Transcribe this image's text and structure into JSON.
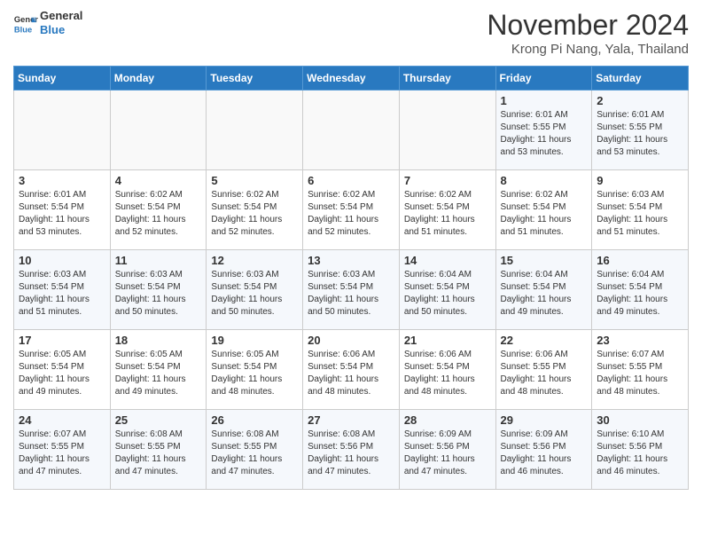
{
  "header": {
    "logo_line1": "General",
    "logo_line2": "Blue",
    "title": "November 2024",
    "subtitle": "Krong Pi Nang, Yala, Thailand"
  },
  "weekdays": [
    "Sunday",
    "Monday",
    "Tuesday",
    "Wednesday",
    "Thursday",
    "Friday",
    "Saturday"
  ],
  "weeks": [
    [
      {
        "day": "",
        "info": ""
      },
      {
        "day": "",
        "info": ""
      },
      {
        "day": "",
        "info": ""
      },
      {
        "day": "",
        "info": ""
      },
      {
        "day": "",
        "info": ""
      },
      {
        "day": "1",
        "info": "Sunrise: 6:01 AM\nSunset: 5:55 PM\nDaylight: 11 hours\nand 53 minutes."
      },
      {
        "day": "2",
        "info": "Sunrise: 6:01 AM\nSunset: 5:55 PM\nDaylight: 11 hours\nand 53 minutes."
      }
    ],
    [
      {
        "day": "3",
        "info": "Sunrise: 6:01 AM\nSunset: 5:54 PM\nDaylight: 11 hours\nand 53 minutes."
      },
      {
        "day": "4",
        "info": "Sunrise: 6:02 AM\nSunset: 5:54 PM\nDaylight: 11 hours\nand 52 minutes."
      },
      {
        "day": "5",
        "info": "Sunrise: 6:02 AM\nSunset: 5:54 PM\nDaylight: 11 hours\nand 52 minutes."
      },
      {
        "day": "6",
        "info": "Sunrise: 6:02 AM\nSunset: 5:54 PM\nDaylight: 11 hours\nand 52 minutes."
      },
      {
        "day": "7",
        "info": "Sunrise: 6:02 AM\nSunset: 5:54 PM\nDaylight: 11 hours\nand 51 minutes."
      },
      {
        "day": "8",
        "info": "Sunrise: 6:02 AM\nSunset: 5:54 PM\nDaylight: 11 hours\nand 51 minutes."
      },
      {
        "day": "9",
        "info": "Sunrise: 6:03 AM\nSunset: 5:54 PM\nDaylight: 11 hours\nand 51 minutes."
      }
    ],
    [
      {
        "day": "10",
        "info": "Sunrise: 6:03 AM\nSunset: 5:54 PM\nDaylight: 11 hours\nand 51 minutes."
      },
      {
        "day": "11",
        "info": "Sunrise: 6:03 AM\nSunset: 5:54 PM\nDaylight: 11 hours\nand 50 minutes."
      },
      {
        "day": "12",
        "info": "Sunrise: 6:03 AM\nSunset: 5:54 PM\nDaylight: 11 hours\nand 50 minutes."
      },
      {
        "day": "13",
        "info": "Sunrise: 6:03 AM\nSunset: 5:54 PM\nDaylight: 11 hours\nand 50 minutes."
      },
      {
        "day": "14",
        "info": "Sunrise: 6:04 AM\nSunset: 5:54 PM\nDaylight: 11 hours\nand 50 minutes."
      },
      {
        "day": "15",
        "info": "Sunrise: 6:04 AM\nSunset: 5:54 PM\nDaylight: 11 hours\nand 49 minutes."
      },
      {
        "day": "16",
        "info": "Sunrise: 6:04 AM\nSunset: 5:54 PM\nDaylight: 11 hours\nand 49 minutes."
      }
    ],
    [
      {
        "day": "17",
        "info": "Sunrise: 6:05 AM\nSunset: 5:54 PM\nDaylight: 11 hours\nand 49 minutes."
      },
      {
        "day": "18",
        "info": "Sunrise: 6:05 AM\nSunset: 5:54 PM\nDaylight: 11 hours\nand 49 minutes."
      },
      {
        "day": "19",
        "info": "Sunrise: 6:05 AM\nSunset: 5:54 PM\nDaylight: 11 hours\nand 48 minutes."
      },
      {
        "day": "20",
        "info": "Sunrise: 6:06 AM\nSunset: 5:54 PM\nDaylight: 11 hours\nand 48 minutes."
      },
      {
        "day": "21",
        "info": "Sunrise: 6:06 AM\nSunset: 5:54 PM\nDaylight: 11 hours\nand 48 minutes."
      },
      {
        "day": "22",
        "info": "Sunrise: 6:06 AM\nSunset: 5:55 PM\nDaylight: 11 hours\nand 48 minutes."
      },
      {
        "day": "23",
        "info": "Sunrise: 6:07 AM\nSunset: 5:55 PM\nDaylight: 11 hours\nand 48 minutes."
      }
    ],
    [
      {
        "day": "24",
        "info": "Sunrise: 6:07 AM\nSunset: 5:55 PM\nDaylight: 11 hours\nand 47 minutes."
      },
      {
        "day": "25",
        "info": "Sunrise: 6:08 AM\nSunset: 5:55 PM\nDaylight: 11 hours\nand 47 minutes."
      },
      {
        "day": "26",
        "info": "Sunrise: 6:08 AM\nSunset: 5:55 PM\nDaylight: 11 hours\nand 47 minutes."
      },
      {
        "day": "27",
        "info": "Sunrise: 6:08 AM\nSunset: 5:56 PM\nDaylight: 11 hours\nand 47 minutes."
      },
      {
        "day": "28",
        "info": "Sunrise: 6:09 AM\nSunset: 5:56 PM\nDaylight: 11 hours\nand 47 minutes."
      },
      {
        "day": "29",
        "info": "Sunrise: 6:09 AM\nSunset: 5:56 PM\nDaylight: 11 hours\nand 46 minutes."
      },
      {
        "day": "30",
        "info": "Sunrise: 6:10 AM\nSunset: 5:56 PM\nDaylight: 11 hours\nand 46 minutes."
      }
    ]
  ]
}
